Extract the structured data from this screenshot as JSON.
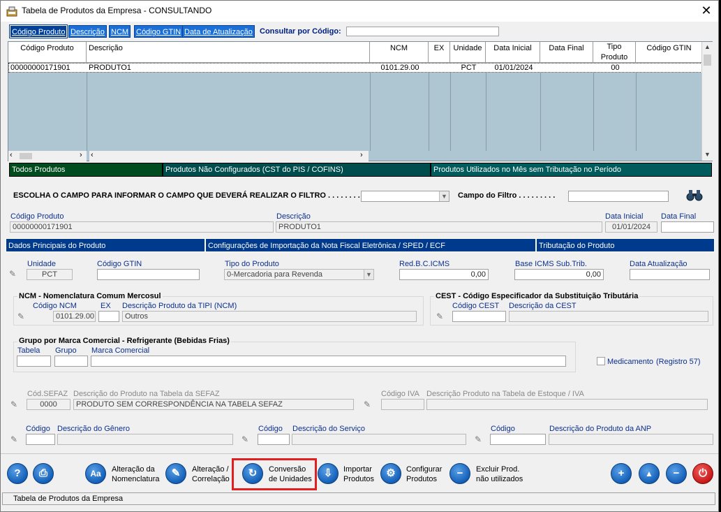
{
  "window": {
    "title": "Tabela de Produtos da Empresa   -   CONSULTANDO",
    "close": "✕"
  },
  "search_tabs": [
    "Código Produto",
    "Descrição",
    "NCM",
    "Código GTIN",
    "Data de Atualização"
  ],
  "search": {
    "label": "Consultar por Código:",
    "value": ""
  },
  "grid": {
    "columns": [
      "Código Produto",
      "Descrição",
      "NCM",
      "EX",
      "Unidade",
      "Data Inicial",
      "Data Final",
      "Tipo\nProduto",
      "Código GTIN"
    ],
    "rows": [
      {
        "codigo": "00000000171901",
        "descricao": "PRODUTO1",
        "ncm": "0101.29.00",
        "ex": "",
        "unidade": "PCT",
        "data_inicial": "01/01/2024",
        "data_final": "",
        "tipo": "00",
        "gtin": ""
      }
    ]
  },
  "filter_bars": [
    "Todos Produtos",
    "Produtos Não Configurados (CST do PIS / COFINS)",
    "Produtos Utilizados no Mês sem Tributação no Período"
  ],
  "filter": {
    "label": "ESCOLHA O CAMPO PARA INFORMAR O CAMPO QUE DEVERÁ REALIZAR O FILTRO . . . . . . . . . :",
    "campo_label": "Campo do Filtro . . . . . . . . .",
    "value": ""
  },
  "detail": {
    "codigo_label": "Código Produto",
    "codigo": "00000000171901",
    "descricao_label": "Descrição",
    "descricao": "PRODUTO1",
    "data_inicial_label": "Data Inicial",
    "data_inicial": "01/01/2024",
    "data_final_label": "Data Final",
    "data_final": ""
  },
  "section_tabs": [
    "Dados Principais do Produto",
    "Configurações de Importação da Nota Fiscal Eletrônica / SPED / ECF",
    "Tributação do Produto"
  ],
  "main": {
    "unidade_label": "Unidade",
    "unidade": "PCT",
    "gtin_label": "Código GTIN",
    "gtin": "",
    "tipo_label": "Tipo do Produto",
    "tipo": "0-Mercadoria para Revenda",
    "redbc_label": "Red.B.C.ICMS",
    "redbc": "0,00",
    "base_label": "Base ICMS Sub.Trib.",
    "base": "0,00",
    "data_atual_label": "Data Atualização",
    "data_atual": ""
  },
  "ncm_group": {
    "title": "NCM - Nomenclatura Comum Mercosul",
    "codigo_label": "Código NCM",
    "codigo": "0101.29.00",
    "ex_label": "EX",
    "ex": "",
    "desc_label": "Descrição Produto da TIPI (NCM)",
    "desc": "Outros"
  },
  "cest_group": {
    "title": "CEST - Código Especificador da Substituição Tributária",
    "codigo_label": "Código CEST",
    "codigo": "",
    "desc_label": "Descrição da CEST",
    "desc": ""
  },
  "marca_group": {
    "title": "Grupo por Marca Comercial - Refrigerante (Bebidas Frias)",
    "tabela_label": "Tabela",
    "grupo_label": "Grupo",
    "marca_label": "Marca Comercial"
  },
  "medicamento": {
    "label": "Medicamento",
    "registro": "(Registro  57)"
  },
  "sefaz": {
    "cod_label": "Cód.SEFAZ",
    "cod": "0000",
    "desc_label": "Descrição do Produto na Tabela da SEFAZ",
    "desc": "PRODUTO SEM CORRESPONDÊNCIA NA TABELA SEFAZ"
  },
  "iva": {
    "cod_label": "Código IVA",
    "desc_label": "Descrição Produto na Tabela de Estoque / IVA"
  },
  "genero": {
    "cod_label": "Código",
    "desc_label": "Descrição do Gênero"
  },
  "servico": {
    "cod_label": "Código",
    "desc_label": "Descrição do Serviço"
  },
  "anp": {
    "cod_label": "Código",
    "desc_label": "Descrição do Produto da ANP"
  },
  "toolbar": {
    "alteracao_nomenclatura": [
      "Alteração da",
      "Nomenclatura"
    ],
    "alteracao_correlacao": [
      "Alteração /",
      "Correlação"
    ],
    "conversao": [
      "Conversão",
      "de Unidades"
    ],
    "importar": [
      "Importar",
      "Produtos"
    ],
    "configurar": [
      "Configurar",
      "Produtos"
    ],
    "excluir": [
      "Excluir Prod.",
      "não utilizados"
    ]
  },
  "status": "Tabela de Produtos da Empresa",
  "colors": {
    "tab_blue": "#1b6fd8",
    "grid_bg": "#adc6d2",
    "filter_green": "#004c1e",
    "filter_teal": "#004d4d",
    "section_navy": "#003a8c",
    "highlight_red": "#e02020"
  }
}
